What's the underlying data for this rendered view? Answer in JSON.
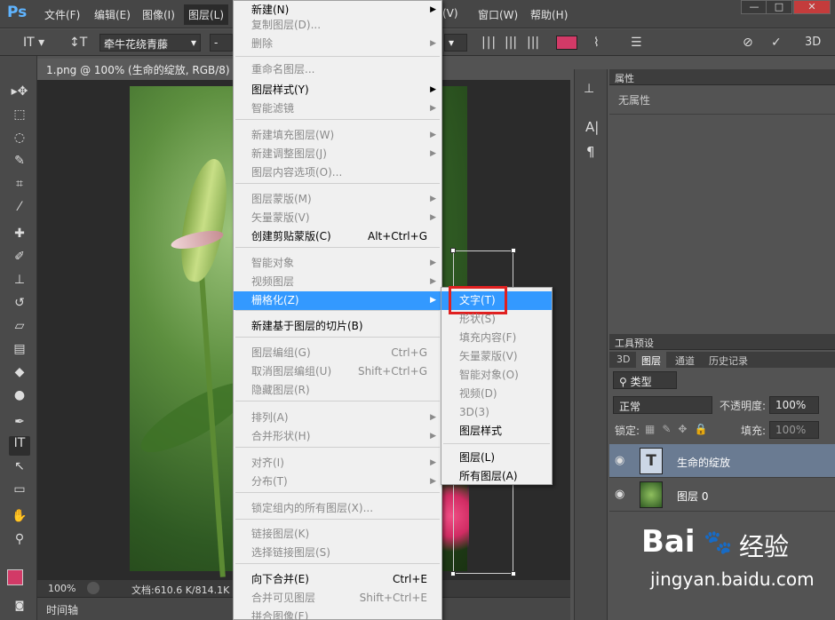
{
  "menubar": {
    "items": [
      "文件(F)",
      "编辑(E)",
      "图像(I)",
      "图层(L)",
      "(V)",
      "窗口(W)",
      "帮助(H)"
    ],
    "app_logo": "Ps",
    "window_buttons": [
      "—",
      "□",
      "✕"
    ]
  },
  "options": {
    "font_family": "牵牛花绕青藤",
    "font_style": "-",
    "align_icons": [
      "align-left-icon",
      "align-center-icon",
      "align-right-icon"
    ],
    "color": "#d23a67",
    "right_icons": [
      "cancel-icon",
      "commit-icon",
      "3d-icon"
    ],
    "threed_label": "3D"
  },
  "document": {
    "tab_title": "1.png @ 100% (生命的绽放, RGB/8) *",
    "zoom": "100%",
    "doc_info": "文档:610.6 K/814.1K",
    "timeline_label": "时间轴"
  },
  "layer_menu": {
    "items": [
      {
        "label": "新建(N)",
        "enabled": true,
        "submenu": true
      },
      {
        "label": "复制图层(D)...",
        "enabled": false
      },
      {
        "label": "删除",
        "enabled": false,
        "submenu": true
      },
      {
        "label": "重命名图层...",
        "enabled": false
      },
      {
        "label": "图层样式(Y)",
        "enabled": true,
        "submenu": true
      },
      {
        "label": "智能滤镜",
        "enabled": false,
        "submenu": true
      },
      {
        "label": "新建填充图层(W)",
        "enabled": false,
        "submenu": true
      },
      {
        "label": "新建调整图层(J)",
        "enabled": false,
        "submenu": true
      },
      {
        "label": "图层内容选项(O)...",
        "enabled": false
      },
      {
        "label": "图层蒙版(M)",
        "enabled": false,
        "submenu": true
      },
      {
        "label": "矢量蒙版(V)",
        "enabled": false,
        "submenu": true
      },
      {
        "label": "创建剪贴蒙版(C)",
        "enabled": true,
        "shortcut": "Alt+Ctrl+G"
      },
      {
        "label": "智能对象",
        "enabled": false,
        "submenu": true
      },
      {
        "label": "视频图层",
        "enabled": false,
        "submenu": true
      },
      {
        "label": "栅格化(Z)",
        "enabled": true,
        "submenu": true,
        "highlighted": true
      },
      {
        "label": "新建基于图层的切片(B)",
        "enabled": true
      },
      {
        "label": "图层编组(G)",
        "enabled": false,
        "shortcut": "Ctrl+G"
      },
      {
        "label": "取消图层编组(U)",
        "enabled": false,
        "shortcut": "Shift+Ctrl+G"
      },
      {
        "label": "隐藏图层(R)",
        "enabled": false
      },
      {
        "label": "排列(A)",
        "enabled": false,
        "submenu": true
      },
      {
        "label": "合并形状(H)",
        "enabled": false,
        "submenu": true
      },
      {
        "label": "对齐(I)",
        "enabled": false,
        "submenu": true
      },
      {
        "label": "分布(T)",
        "enabled": false,
        "submenu": true
      },
      {
        "label": "锁定组内的所有图层(X)...",
        "enabled": false
      },
      {
        "label": "链接图层(K)",
        "enabled": false
      },
      {
        "label": "选择链接图层(S)",
        "enabled": false
      },
      {
        "label": "向下合并(E)",
        "enabled": true,
        "shortcut": "Ctrl+E"
      },
      {
        "label": "合并可见图层",
        "enabled": false,
        "shortcut": "Shift+Ctrl+E"
      },
      {
        "label": "拼合图像(F)",
        "enabled": false
      }
    ]
  },
  "rasterize_submenu": {
    "items": [
      {
        "label": "文字(T)",
        "enabled": true,
        "highlighted": true
      },
      {
        "label": "形状(S)",
        "enabled": false
      },
      {
        "label": "填充内容(F)",
        "enabled": false
      },
      {
        "label": "矢量蒙版(V)",
        "enabled": false
      },
      {
        "label": "智能对象(O)",
        "enabled": false
      },
      {
        "label": "视频(D)",
        "enabled": false
      },
      {
        "label": "3D(3)",
        "enabled": false
      },
      {
        "label": "图层样式",
        "enabled": true
      },
      {
        "label": "图层(L)",
        "enabled": true
      },
      {
        "label": "所有图层(A)",
        "enabled": true
      }
    ],
    "highlight_color": "#e02020"
  },
  "properties_panel": {
    "title": "属性",
    "empty_text": "无属性"
  },
  "tool_presets_panel": {
    "title": "工具预设"
  },
  "layers_panel": {
    "tabs": [
      "3D",
      "图层",
      "通道",
      "历史记录"
    ],
    "active_tab": "图层",
    "filter_label": "类型",
    "blend_mode": "正常",
    "opacity_label": "不透明度:",
    "opacity_value": "100%",
    "lock_label": "锁定:",
    "fill_label": "填充:",
    "fill_value": "100%",
    "layers": [
      {
        "name": "生命的绽放",
        "kind": "text",
        "selected": true
      },
      {
        "name": "图层 0",
        "kind": "image",
        "selected": false
      }
    ]
  },
  "watermark": {
    "brand": "Bai",
    "brand_cn": "经验",
    "url": "jingyan.baidu.com"
  },
  "colors": {
    "foreground": "#d23a67",
    "background": "#ffffff",
    "menu_highlight": "#3399ff",
    "selected_layer": "#6a7b92"
  }
}
